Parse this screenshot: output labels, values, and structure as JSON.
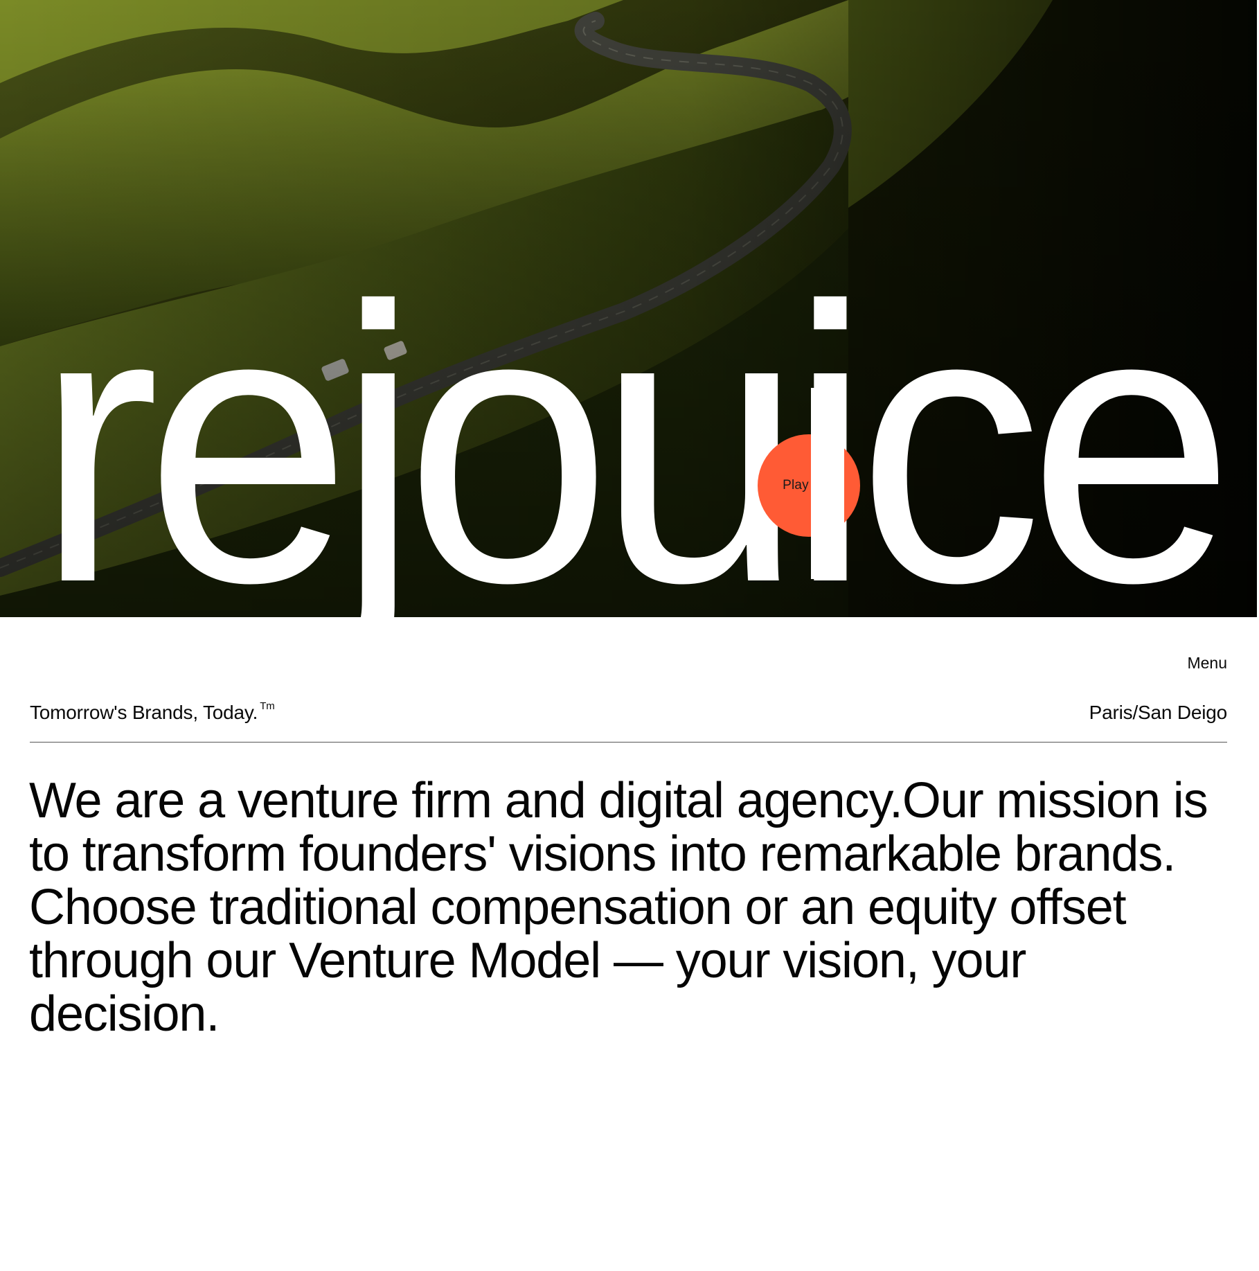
{
  "brand": {
    "wordmark": "rejouice"
  },
  "hero": {
    "play_label": "Play reel"
  },
  "header": {
    "menu_label": "Menu",
    "tagline": "Tomorrow's Brands, Today.",
    "tagline_mark": "Tm",
    "location": "Paris/San Deigo"
  },
  "mission": {
    "text": "We are a venture firm and digital agency.Our mission is\nto transform founders' visions into remarkable brands.\nChoose  traditional compensation or an equity offset\nthrough our Venture Model — your vision, your\ndecision."
  },
  "colors": {
    "accent": "#ff5b35",
    "text": "#0a0a0a",
    "background": "#ffffff",
    "wordmark": "#ffffff"
  }
}
